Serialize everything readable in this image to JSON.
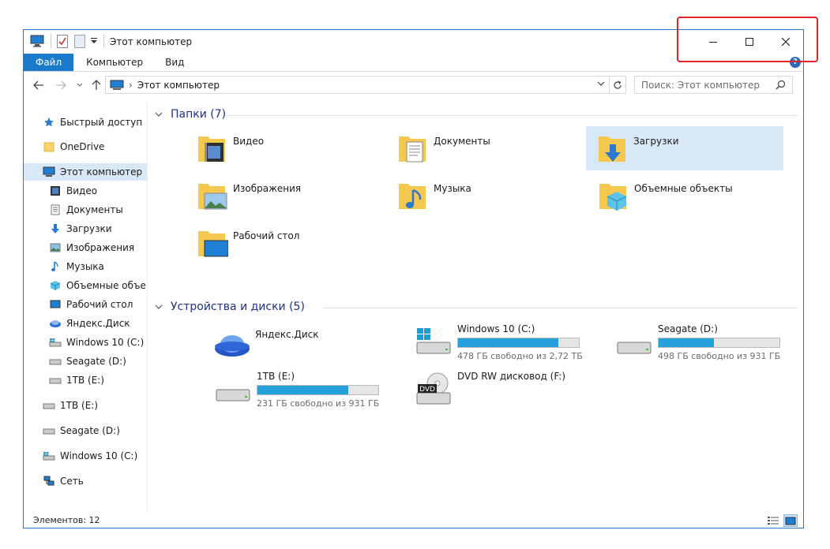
{
  "window": {
    "title": "Этот компьютер",
    "accent": "#1979ca",
    "help_label": "?"
  },
  "ribbon": {
    "tabs": [
      "Файл",
      "Компьютер",
      "Вид"
    ]
  },
  "address": {
    "path": "Этот компьютер",
    "separator": "›",
    "search_placeholder": "Поиск: Этот компьютер"
  },
  "navpane": {
    "items": [
      {
        "label": "Быстрый доступ",
        "icon": "star-icon"
      },
      {
        "label": "OneDrive",
        "icon": "onedrive-folder-icon"
      },
      {
        "label": "Этот компьютер",
        "icon": "computer-icon",
        "selected": true
      },
      {
        "label": "Видео",
        "icon": "video-icon"
      },
      {
        "label": "Документы",
        "icon": "document-icon"
      },
      {
        "label": "Загрузки",
        "icon": "download-icon"
      },
      {
        "label": "Изображения",
        "icon": "image-icon"
      },
      {
        "label": "Музыка",
        "icon": "music-icon"
      },
      {
        "label": "Объемные объекты",
        "icon": "3d-objects-icon"
      },
      {
        "label": "Рабочий стол",
        "icon": "desktop-icon"
      },
      {
        "label": "Яндекс.Диск",
        "icon": "yandex-disk-icon"
      },
      {
        "label": "Windows 10 (C:)",
        "icon": "windows-drive-icon"
      },
      {
        "label": "Seagate (D:)",
        "icon": "drive-icon"
      },
      {
        "label": "1TB (E:)",
        "icon": "drive-icon"
      },
      {
        "label": "1TB (E:)",
        "icon": "drive-icon"
      },
      {
        "label": "Seagate (D:)",
        "icon": "drive-icon"
      },
      {
        "label": "Windows 10 (C:)",
        "icon": "windows-drive-icon"
      },
      {
        "label": "Сеть",
        "icon": "network-icon"
      }
    ]
  },
  "folders": {
    "header": "Папки (7)",
    "items": [
      {
        "label": "Видео",
        "icon": "video-folder-icon"
      },
      {
        "label": "Документы",
        "icon": "documents-folder-icon"
      },
      {
        "label": "Загрузки",
        "icon": "downloads-folder-icon",
        "selected": true
      },
      {
        "label": "Изображения",
        "icon": "pictures-folder-icon"
      },
      {
        "label": "Музыка",
        "icon": "music-folder-icon"
      },
      {
        "label": "Объемные объекты",
        "icon": "3d-objects-folder-icon"
      },
      {
        "label": "Рабочий стол",
        "icon": "desktop-folder-icon"
      }
    ]
  },
  "devices": {
    "header": "Устройства и диски (5)",
    "items": [
      {
        "label": "Яндекс.Диск",
        "icon": "yandex-disk-icon"
      },
      {
        "label": "Windows 10 (C:)",
        "icon": "windows-drive-icon",
        "free_text": "478 ГБ свободно из 2,72 ТБ",
        "used_fraction": 0.83
      },
      {
        "label": "Seagate (D:)",
        "icon": "drive-icon",
        "free_text": "498 ГБ свободно из 931 ГБ",
        "used_fraction": 0.46
      },
      {
        "label": "1TB (E:)",
        "icon": "drive-icon",
        "free_text": "231 ГБ свободно из 931 ГБ",
        "used_fraction": 0.75
      },
      {
        "label": "DVD RW дисковод (F:)",
        "icon": "dvd-drive-icon",
        "badge": "DVD"
      }
    ]
  },
  "status": {
    "items_text": "Элементов: 12"
  }
}
